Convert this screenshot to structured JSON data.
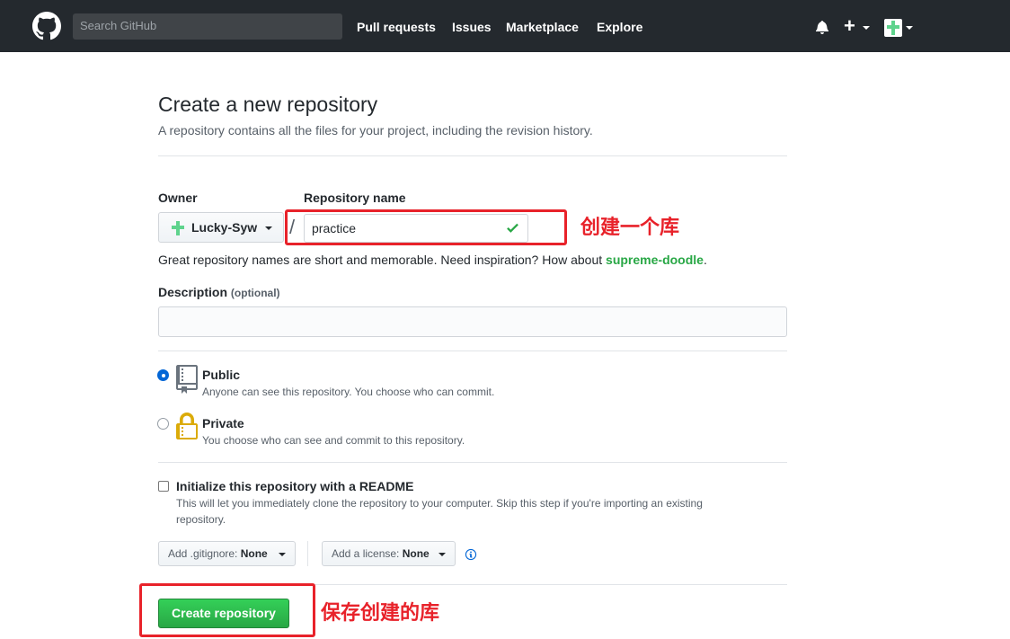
{
  "header": {
    "search_placeholder": "Search GitHub",
    "nav": [
      "Pull requests",
      "Issues",
      "Marketplace",
      "Explore"
    ]
  },
  "page": {
    "title": "Create a new repository",
    "subtitle": "A repository contains all the files for your project, including the revision history."
  },
  "form": {
    "owner_label": "Owner",
    "owner_value": "Lucky-Syw",
    "repo_label": "Repository name",
    "repo_value": "practice",
    "separator": "/",
    "hint_prefix": "Great repository names are short and memorable. Need inspiration? How about ",
    "hint_suggestion": "supreme-doodle",
    "hint_suffix": ".",
    "description_label": "Description",
    "description_optional": "(optional)",
    "description_value": "",
    "visibility": [
      {
        "title": "Public",
        "desc": "Anyone can see this repository. You choose who can commit.",
        "selected": true
      },
      {
        "title": "Private",
        "desc": "You choose who can see and commit to this repository.",
        "selected": false
      }
    ],
    "readme_title": "Initialize this repository with a README",
    "readme_desc_line1": "This will let you immediately clone the repository to your computer. Skip this step if you're importing an existing",
    "readme_desc_line2": "repository.",
    "readme_checked": false,
    "gitignore_label": "Add .gitignore:",
    "gitignore_value": "None",
    "license_label": "Add a license:",
    "license_value": "None",
    "submit_label": "Create repository"
  },
  "annotations": {
    "repo_note": "创建一个库",
    "submit_note": "保存创建的库",
    "color": "#e8222a"
  },
  "colors": {
    "header_bg": "#24292e",
    "primary_green": "#28a745",
    "radio_blue": "#0366d6"
  }
}
